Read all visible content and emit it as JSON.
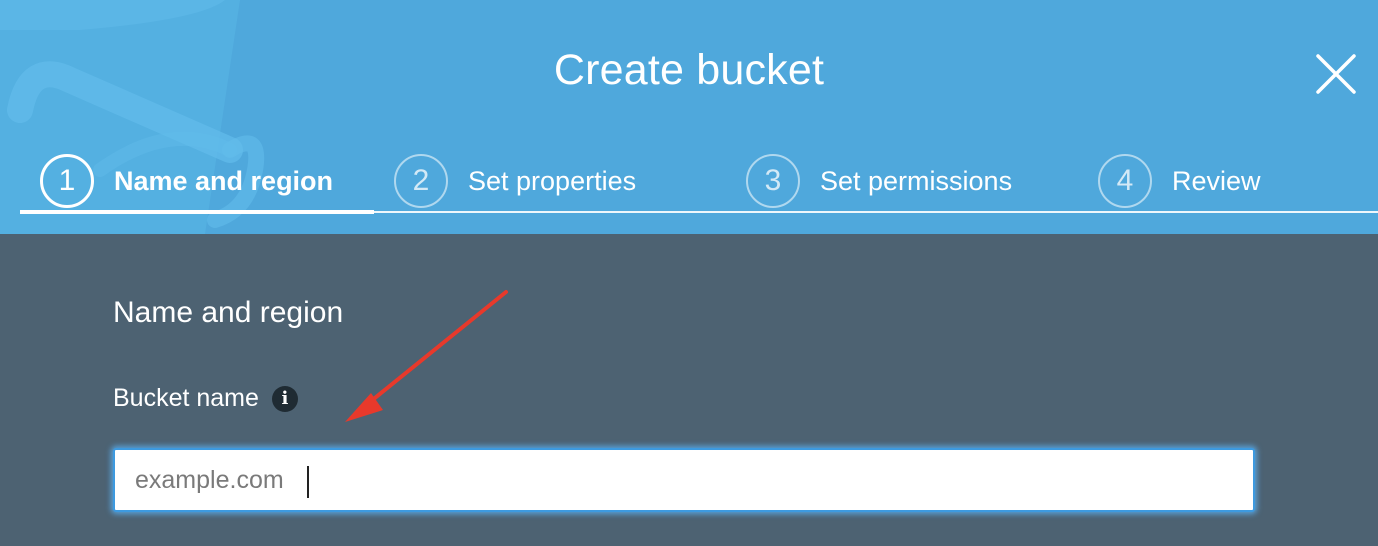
{
  "modal": {
    "title": "Create bucket",
    "accent_color": "#4fa8dc",
    "body_color": "#4d6272"
  },
  "steps": [
    {
      "number": "1",
      "label": "Name and region",
      "active": true
    },
    {
      "number": "2",
      "label": "Set properties",
      "active": false
    },
    {
      "number": "3",
      "label": "Set permissions",
      "active": false
    },
    {
      "number": "4",
      "label": "Review",
      "active": false
    }
  ],
  "form": {
    "section_title": "Name and region",
    "bucket_name_label": "Bucket name",
    "bucket_name_value": "",
    "bucket_name_placeholder": "example.com",
    "info_icon": "info-icon"
  },
  "annotation": {
    "arrow_color": "#e8392b"
  }
}
